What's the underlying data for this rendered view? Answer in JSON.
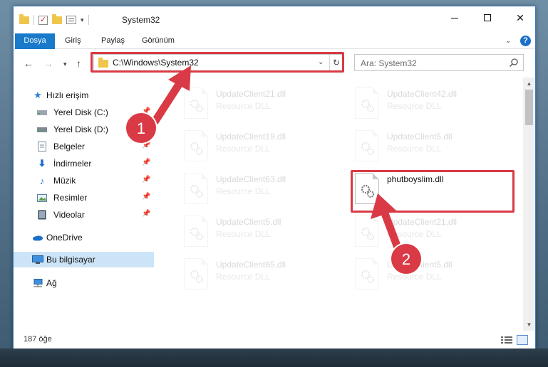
{
  "window": {
    "title": "System32",
    "controls": {
      "minimize": "minimize-icon",
      "maximize": "maximize-icon",
      "close": "✕"
    }
  },
  "ribbon": {
    "file_tab": "Dosya",
    "tabs": [
      "Giriş",
      "Paylaş",
      "Görünüm"
    ],
    "help": "?"
  },
  "address": {
    "path": "C:\\Windows\\System32",
    "search_placeholder": "Ara: System32"
  },
  "nav_pane": {
    "quick_access": "Hızlı erişim",
    "items": [
      {
        "label": "Yerel Disk (C:)",
        "icon": "drive-icon",
        "pinned": true
      },
      {
        "label": "Yerel Disk (D:)",
        "icon": "drive-icon",
        "pinned": true
      },
      {
        "label": "Belgeler",
        "icon": "documents-icon",
        "pinned": true
      },
      {
        "label": "İndirmeler",
        "icon": "downloads-icon",
        "pinned": true
      },
      {
        "label": "Müzik",
        "icon": "music-icon",
        "pinned": true
      },
      {
        "label": "Resimler",
        "icon": "pictures-icon",
        "pinned": true
      },
      {
        "label": "Videolar",
        "icon": "videos-icon",
        "pinned": true
      }
    ],
    "onedrive": "OneDrive",
    "this_pc": "Bu bilgisayar",
    "network": "Ağ"
  },
  "files": [
    {
      "name": "UpdateClient21.dll",
      "type": "Resource DLL"
    },
    {
      "name": "UpdateClient42.dll",
      "type": "Resource DLL"
    },
    {
      "name": "UpdateClient19.dll",
      "type": "Resource DLL"
    },
    {
      "name": "UpdateClient5.dll",
      "type": "Resource DLL"
    },
    {
      "name": "UpdateClient63.dll",
      "type": "Resource DLL"
    },
    {
      "name": "phutboyslim.dll",
      "type": ""
    },
    {
      "name": "UpdateClient5.dll",
      "type": "Resource DLL"
    },
    {
      "name": "UpdateClient21.dll",
      "type": "Resource DLL"
    },
    {
      "name": "UpdateClient65.dll",
      "type": "Resource DLL"
    },
    {
      "name": "UpdateClient5.dll",
      "type": "Resource DLL"
    }
  ],
  "status": {
    "item_count": "187 öğe"
  },
  "annotations": {
    "step1": "1",
    "step2": "2",
    "color": "#d93a45"
  }
}
